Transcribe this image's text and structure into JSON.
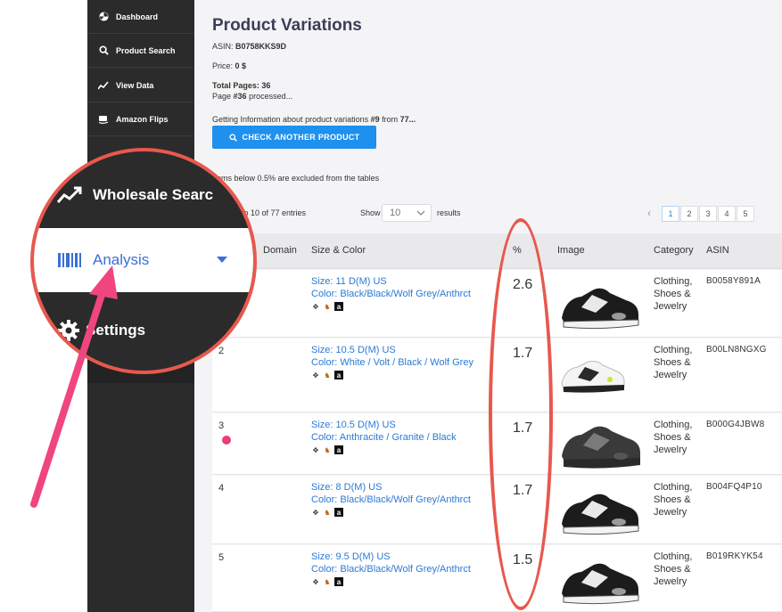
{
  "sidebar": {
    "items": [
      {
        "label": "Dashboard",
        "icon": "dashboard-icon"
      },
      {
        "label": "Product Search",
        "icon": "search-icon"
      },
      {
        "label": "View Data",
        "icon": "chart-line-icon"
      },
      {
        "label": "Amazon Flips",
        "icon": "amazon-icon"
      }
    ]
  },
  "magnifier": {
    "wholesale": "Wholesale Searc",
    "analysis": "Analysis",
    "settings": "Settings"
  },
  "page": {
    "title": "Product Variations",
    "asin_label": "ASIN:",
    "asin_value": "B0758KKS9D",
    "price_label": "Price:",
    "price_value": "0 $",
    "total_pages_label": "Total Pages:",
    "total_pages_value": "36",
    "page_word": "Page",
    "page_num": "#36",
    "processed": "processed...",
    "getting_info": "Getting Information about product variations",
    "getting_num": "#9",
    "getting_from": "from",
    "getting_total": "77...",
    "check_button": "CHECK ANOTHER PRODUCT",
    "note": "Items below 0.5% are excluded from the tables",
    "entries": "g 1 to 10 of 77 entries",
    "show_label": "Show",
    "show_value": "10",
    "results_label": "results"
  },
  "pagination": [
    "1",
    "2",
    "3",
    "4",
    "5"
  ],
  "table": {
    "headers": {
      "domain": "Domain",
      "size": "Size & Color",
      "pct": "%",
      "image": "Image",
      "category": "Category",
      "asin": "ASIN"
    },
    "rows": [
      {
        "num": "",
        "size": "Size: 11 D(M) US",
        "color": "Color: Black/Black/Wolf Grey/Anthrct",
        "pct": "2.6",
        "cat1": "Clothing,",
        "cat2": "Shoes &",
        "cat3": "Jewelry",
        "asin": "B0058Y891A"
      },
      {
        "num": "2",
        "size": "Size: 10.5 D(M) US",
        "color": "Color: White / Volt / Black / Wolf Grey",
        "pct": "1.7",
        "cat1": "Clothing,",
        "cat2": "Shoes &",
        "cat3": "Jewelry",
        "asin": "B00LN8NGXG"
      },
      {
        "num": "3",
        "size": "Size: 10.5 D(M) US",
        "color": "Color: Anthracite / Granite / Black",
        "pct": "1.7",
        "cat1": "Clothing,",
        "cat2": "Shoes &",
        "cat3": "Jewelry",
        "asin": "B000G4JBW8"
      },
      {
        "num": "4",
        "size": "Size: 8 D(M) US",
        "color": "Color: Black/Black/Wolf Grey/Anthrct",
        "pct": "1.7",
        "cat1": "Clothing,",
        "cat2": "Shoes &",
        "cat3": "Jewelry",
        "asin": "B004FQ4P10"
      },
      {
        "num": "5",
        "size": "Size: 9.5 D(M) US",
        "color": "Color: Black/Black/Wolf Grey/Anthrct",
        "pct": "1.5",
        "cat1": "Clothing,",
        "cat2": "Shoes &",
        "cat3": "Jewelry",
        "asin": "B019RKYK54"
      }
    ]
  },
  "colors": {
    "accent": "#1e90ee",
    "highlight": "#e8584e",
    "arrow": "#f0457e"
  }
}
